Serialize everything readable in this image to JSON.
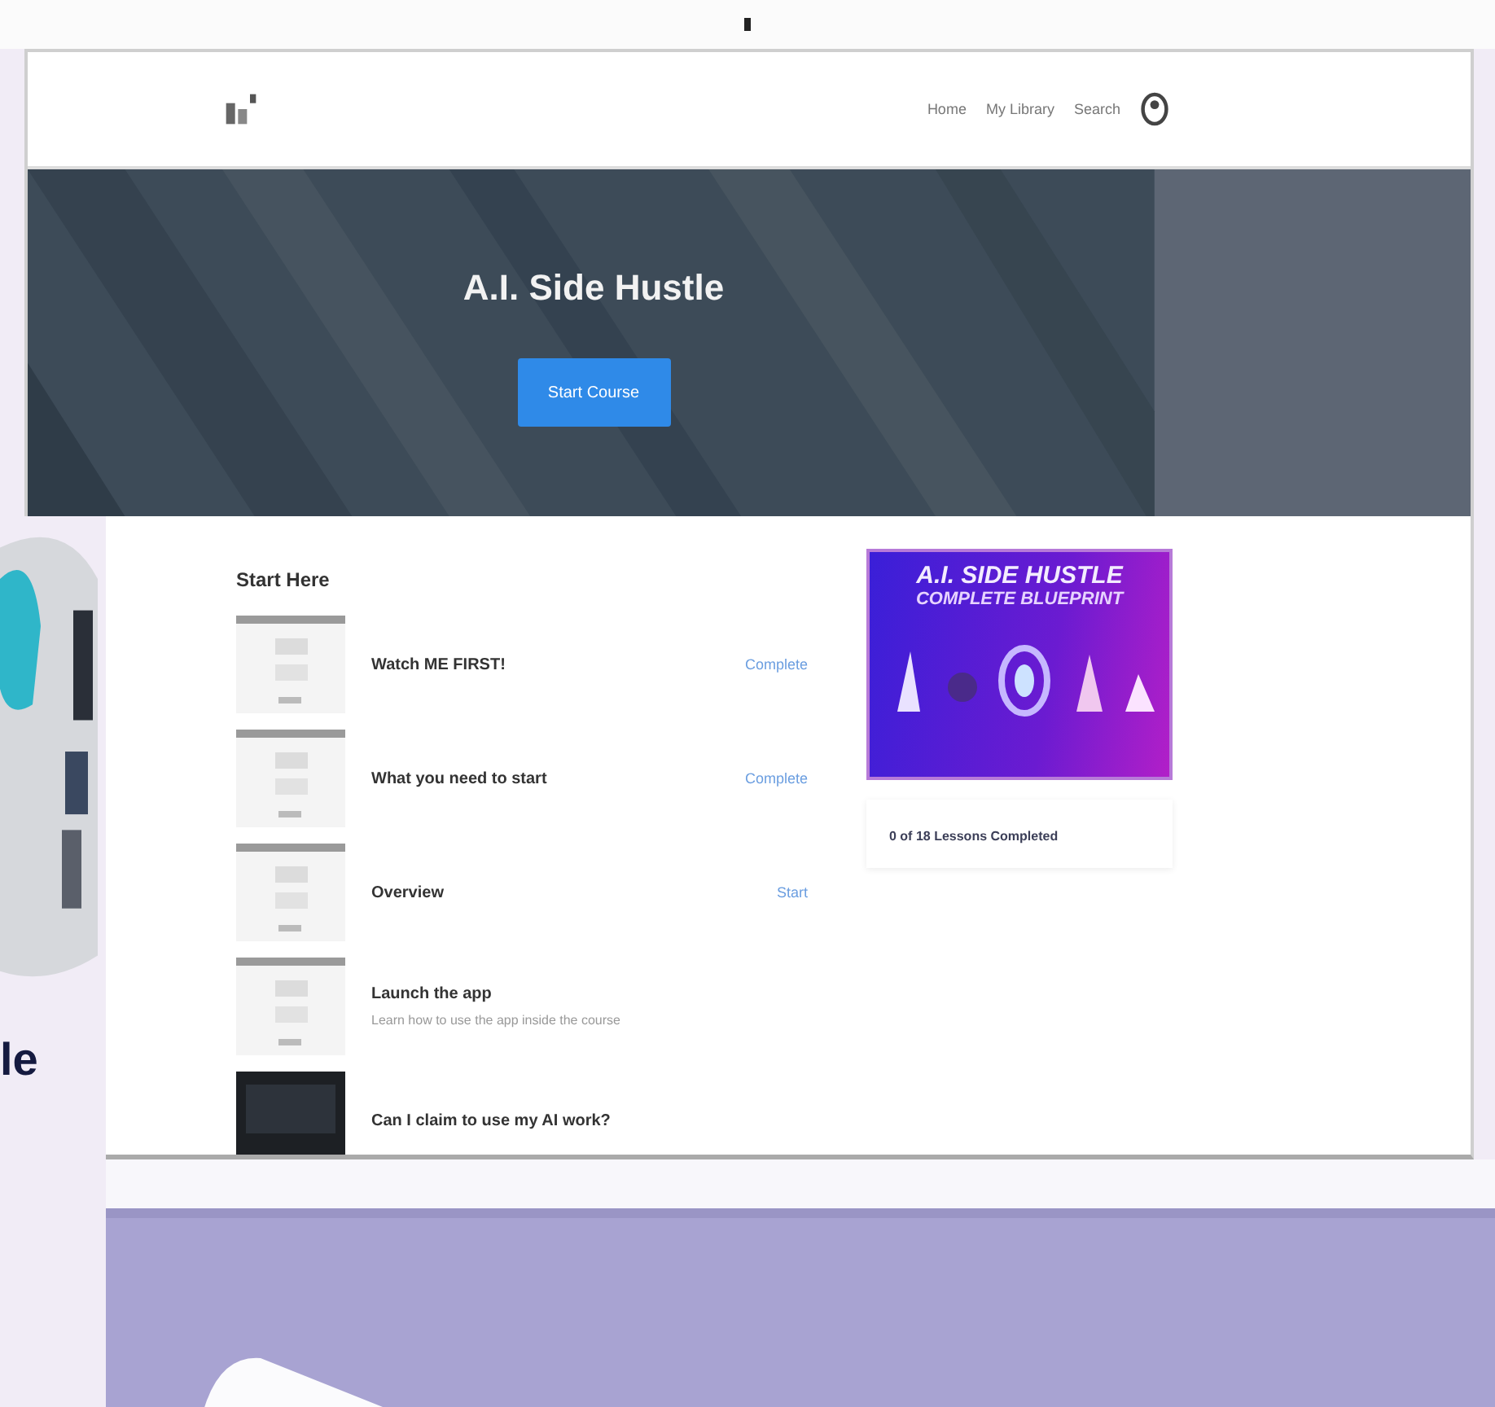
{
  "header": {
    "nav_links": [
      "Home",
      "My Library",
      "Search"
    ]
  },
  "hero": {
    "title": "A.I. Side Hustle",
    "button": "Start Course"
  },
  "course": {
    "section_title": "Start Here",
    "lessons": [
      {
        "title": "Watch ME FIRST!",
        "status": "Complete",
        "kind": "light"
      },
      {
        "title": "What you need to start",
        "status": "Complete",
        "kind": "light"
      },
      {
        "title": "Overview",
        "status": "Start",
        "kind": "light"
      },
      {
        "title": "Launch the app",
        "subtitle": "Learn how to use the app inside the course",
        "kind": "light"
      },
      {
        "title": "Can I claim to use my AI work?",
        "kind": "dark"
      }
    ]
  },
  "sidebar": {
    "cover_title": "A.I. SIDE HUSTLE",
    "cover_subtitle": "COMPLETE BLUEPRINT",
    "progress": "0 of 18 Lessons Completed"
  },
  "backdrop": {
    "poster_text": "le"
  }
}
